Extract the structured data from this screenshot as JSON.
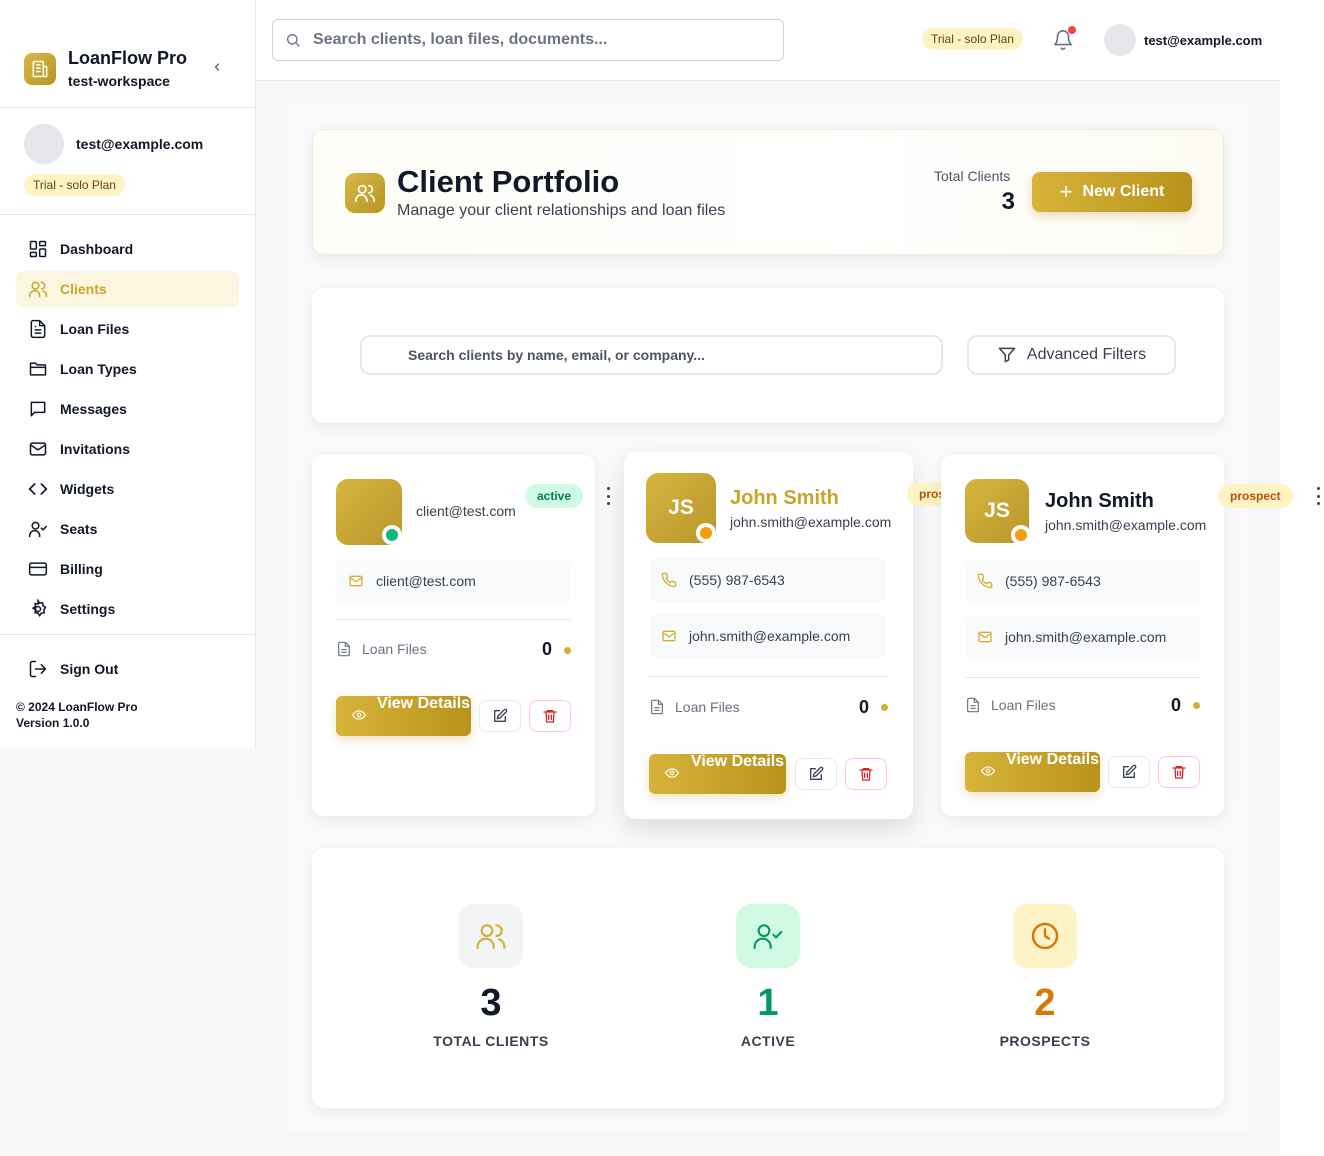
{
  "app": {
    "name": "LoanFlow Pro",
    "workspace": "test-workspace",
    "user_email": "test@example.com",
    "plan": "Trial - solo Plan",
    "copyright": "© 2024 LoanFlow Pro",
    "version": "Version 1.0.0"
  },
  "topbar": {
    "search_placeholder": "Search clients, loan files, documents...",
    "plan": "Trial - solo Plan",
    "user_email": "test@example.com"
  },
  "sidebar": {
    "items": [
      {
        "label": "Dashboard",
        "icon": "dashboard-icon"
      },
      {
        "label": "Clients",
        "icon": "users-icon",
        "active": true
      },
      {
        "label": "Loan Files",
        "icon": "file-icon"
      },
      {
        "label": "Loan Types",
        "icon": "folder-icon"
      },
      {
        "label": "Messages",
        "icon": "message-icon"
      },
      {
        "label": "Invitations",
        "icon": "mail-icon"
      },
      {
        "label": "Widgets",
        "icon": "code-icon"
      },
      {
        "label": "Seats",
        "icon": "user-check-icon"
      },
      {
        "label": "Billing",
        "icon": "credit-card-icon"
      },
      {
        "label": "Settings",
        "icon": "gear-icon"
      }
    ],
    "sign_out": "Sign Out"
  },
  "header": {
    "title": "Client Portfolio",
    "subtitle": "Manage your client relationships and loan files",
    "total_label": "Total Clients",
    "total_value": "3",
    "new_client": "New Client"
  },
  "filters": {
    "search_placeholder": "Search clients by name, email, or company...",
    "advanced": "Advanced Filters"
  },
  "clients": [
    {
      "initials": "",
      "name": "",
      "email": "client@test.com",
      "status": "active",
      "status_color": "#10b981",
      "loan_files_label": "Loan Files",
      "loan_files": "0",
      "view_label": "View Details"
    },
    {
      "initials": "JS",
      "name": "John Smith",
      "email": "john.smith@example.com",
      "phone": "(555) 987-6543",
      "status": "prospect",
      "status_color": "#f59e0b",
      "loan_files_label": "Loan Files",
      "loan_files": "0",
      "view_label": "View Details"
    },
    {
      "initials": "JS",
      "name": "John Smith",
      "email": "john.smith@example.com",
      "phone": "(555) 987-6543",
      "status": "prospect",
      "status_color": "#f59e0b",
      "loan_files_label": "Loan Files",
      "loan_files": "0",
      "view_label": "View Details"
    }
  ],
  "stats": [
    {
      "value": "3",
      "label": "TOTAL CLIENTS",
      "color": "#111827",
      "icon": "users-icon"
    },
    {
      "value": "1",
      "label": "ACTIVE",
      "color": "#059669",
      "icon": "user-check-icon"
    },
    {
      "value": "2",
      "label": "PROSPECTS",
      "color": "#d97706",
      "icon": "clock-icon"
    }
  ],
  "colors": {
    "accent": "#c9a52c",
    "accent_dark": "#b8931b",
    "active": "#10b981",
    "prospect": "#f59e0b"
  }
}
